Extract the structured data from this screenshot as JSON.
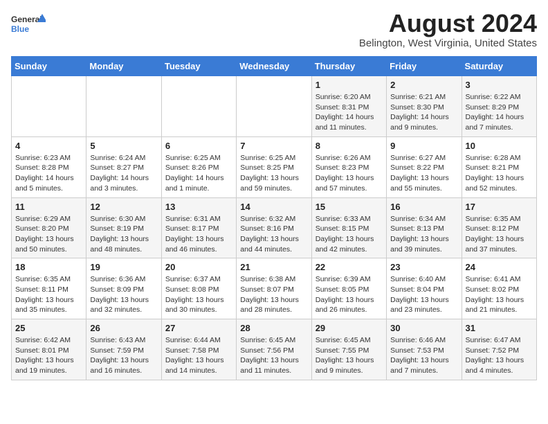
{
  "logo": {
    "general": "General",
    "blue": "Blue"
  },
  "header": {
    "month": "August 2024",
    "location": "Belington, West Virginia, United States"
  },
  "days_of_week": [
    "Sunday",
    "Monday",
    "Tuesday",
    "Wednesday",
    "Thursday",
    "Friday",
    "Saturday"
  ],
  "weeks": [
    [
      {
        "day": "",
        "info": ""
      },
      {
        "day": "",
        "info": ""
      },
      {
        "day": "",
        "info": ""
      },
      {
        "day": "",
        "info": ""
      },
      {
        "day": "1",
        "info": "Sunrise: 6:20 AM\nSunset: 8:31 PM\nDaylight: 14 hours and 11 minutes."
      },
      {
        "day": "2",
        "info": "Sunrise: 6:21 AM\nSunset: 8:30 PM\nDaylight: 14 hours and 9 minutes."
      },
      {
        "day": "3",
        "info": "Sunrise: 6:22 AM\nSunset: 8:29 PM\nDaylight: 14 hours and 7 minutes."
      }
    ],
    [
      {
        "day": "4",
        "info": "Sunrise: 6:23 AM\nSunset: 8:28 PM\nDaylight: 14 hours and 5 minutes."
      },
      {
        "day": "5",
        "info": "Sunrise: 6:24 AM\nSunset: 8:27 PM\nDaylight: 14 hours and 3 minutes."
      },
      {
        "day": "6",
        "info": "Sunrise: 6:25 AM\nSunset: 8:26 PM\nDaylight: 14 hours and 1 minute."
      },
      {
        "day": "7",
        "info": "Sunrise: 6:25 AM\nSunset: 8:25 PM\nDaylight: 13 hours and 59 minutes."
      },
      {
        "day": "8",
        "info": "Sunrise: 6:26 AM\nSunset: 8:23 PM\nDaylight: 13 hours and 57 minutes."
      },
      {
        "day": "9",
        "info": "Sunrise: 6:27 AM\nSunset: 8:22 PM\nDaylight: 13 hours and 55 minutes."
      },
      {
        "day": "10",
        "info": "Sunrise: 6:28 AM\nSunset: 8:21 PM\nDaylight: 13 hours and 52 minutes."
      }
    ],
    [
      {
        "day": "11",
        "info": "Sunrise: 6:29 AM\nSunset: 8:20 PM\nDaylight: 13 hours and 50 minutes."
      },
      {
        "day": "12",
        "info": "Sunrise: 6:30 AM\nSunset: 8:19 PM\nDaylight: 13 hours and 48 minutes."
      },
      {
        "day": "13",
        "info": "Sunrise: 6:31 AM\nSunset: 8:17 PM\nDaylight: 13 hours and 46 minutes."
      },
      {
        "day": "14",
        "info": "Sunrise: 6:32 AM\nSunset: 8:16 PM\nDaylight: 13 hours and 44 minutes."
      },
      {
        "day": "15",
        "info": "Sunrise: 6:33 AM\nSunset: 8:15 PM\nDaylight: 13 hours and 42 minutes."
      },
      {
        "day": "16",
        "info": "Sunrise: 6:34 AM\nSunset: 8:13 PM\nDaylight: 13 hours and 39 minutes."
      },
      {
        "day": "17",
        "info": "Sunrise: 6:35 AM\nSunset: 8:12 PM\nDaylight: 13 hours and 37 minutes."
      }
    ],
    [
      {
        "day": "18",
        "info": "Sunrise: 6:35 AM\nSunset: 8:11 PM\nDaylight: 13 hours and 35 minutes."
      },
      {
        "day": "19",
        "info": "Sunrise: 6:36 AM\nSunset: 8:09 PM\nDaylight: 13 hours and 32 minutes."
      },
      {
        "day": "20",
        "info": "Sunrise: 6:37 AM\nSunset: 8:08 PM\nDaylight: 13 hours and 30 minutes."
      },
      {
        "day": "21",
        "info": "Sunrise: 6:38 AM\nSunset: 8:07 PM\nDaylight: 13 hours and 28 minutes."
      },
      {
        "day": "22",
        "info": "Sunrise: 6:39 AM\nSunset: 8:05 PM\nDaylight: 13 hours and 26 minutes."
      },
      {
        "day": "23",
        "info": "Sunrise: 6:40 AM\nSunset: 8:04 PM\nDaylight: 13 hours and 23 minutes."
      },
      {
        "day": "24",
        "info": "Sunrise: 6:41 AM\nSunset: 8:02 PM\nDaylight: 13 hours and 21 minutes."
      }
    ],
    [
      {
        "day": "25",
        "info": "Sunrise: 6:42 AM\nSunset: 8:01 PM\nDaylight: 13 hours and 19 minutes."
      },
      {
        "day": "26",
        "info": "Sunrise: 6:43 AM\nSunset: 7:59 PM\nDaylight: 13 hours and 16 minutes."
      },
      {
        "day": "27",
        "info": "Sunrise: 6:44 AM\nSunset: 7:58 PM\nDaylight: 13 hours and 14 minutes."
      },
      {
        "day": "28",
        "info": "Sunrise: 6:45 AM\nSunset: 7:56 PM\nDaylight: 13 hours and 11 minutes."
      },
      {
        "day": "29",
        "info": "Sunrise: 6:45 AM\nSunset: 7:55 PM\nDaylight: 13 hours and 9 minutes."
      },
      {
        "day": "30",
        "info": "Sunrise: 6:46 AM\nSunset: 7:53 PM\nDaylight: 13 hours and 7 minutes."
      },
      {
        "day": "31",
        "info": "Sunrise: 6:47 AM\nSunset: 7:52 PM\nDaylight: 13 hours and 4 minutes."
      }
    ]
  ]
}
